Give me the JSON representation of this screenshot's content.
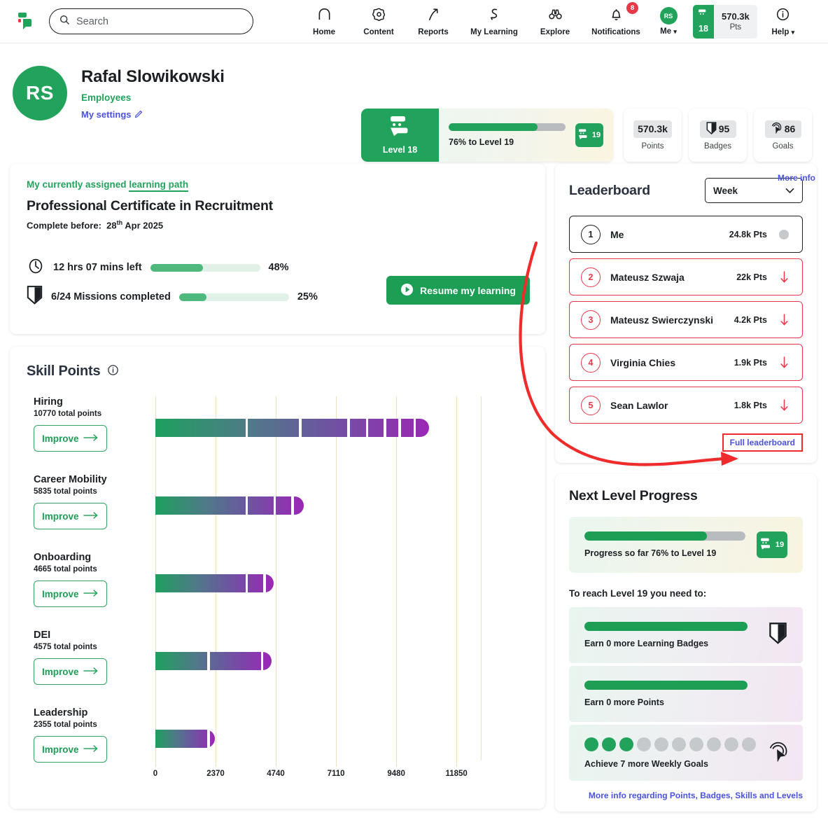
{
  "colors": {
    "brand_green": "#22a35c",
    "link_blue": "#4a52e0",
    "alert_red": "#e8394a",
    "anno_red": "#ef2b2b",
    "gridline": "#f0dfc0",
    "bar_start": "#1ea05e",
    "bar_end": "#9b27b5"
  },
  "topnav": {
    "logo_icon": "speech-bubble-logo-icon",
    "search": {
      "placeholder": "Search",
      "value": "",
      "icon": "search-icon"
    },
    "items": [
      {
        "label": "Home",
        "icon": "home-icon"
      },
      {
        "label": "Content",
        "icon": "gear-flower-icon"
      },
      {
        "label": "Reports",
        "icon": "arrow-trend-up-icon"
      },
      {
        "label": "My Learning",
        "icon": "ribbon-path-icon"
      },
      {
        "label": "Explore",
        "icon": "binoculars-icon"
      },
      {
        "label": "Notifications",
        "icon": "bell-icon",
        "badge": "8"
      }
    ],
    "me": {
      "label": "Me",
      "initials": "RS",
      "chevron": "chevron-down-icon"
    },
    "points_widget": {
      "level": "18",
      "level_icon": "level-badge-icon",
      "value": "570.3k",
      "unit": "Pts"
    },
    "help": {
      "label": "Help",
      "icon": "info-circle-icon",
      "chevron": "chevron-down-icon"
    }
  },
  "profile": {
    "initials": "RS",
    "name": "Rafal Slowikowski",
    "group": "Employees",
    "settings_link": "My settings",
    "settings_icon": "pencil-icon",
    "level_card": {
      "badge_icon": "level-badge-icon",
      "badge_label": "Level 18",
      "progress_pct": 76,
      "progress_text": "76% to Level 19",
      "next_level_chip": "19",
      "chip_icon": "level-badge-icon"
    },
    "stats": [
      {
        "value": "570.3k",
        "caption": "Points",
        "icon": ""
      },
      {
        "value": "95",
        "caption": "Badges",
        "icon": "badge-shield-icon"
      },
      {
        "value": "86",
        "caption": "Goals",
        "icon": "goal-target-icon"
      }
    ],
    "more_info": "More info"
  },
  "learning_path": {
    "eyebrow_prefix": "My currently assigned ",
    "eyebrow_link": "learning path",
    "title": "Professional Certificate in Recruitment",
    "due_label": "Complete before:",
    "due_day": "28",
    "due_suffix": "th",
    "due_rest": " Apr 2025",
    "rows": [
      {
        "icon": "clock-icon",
        "text": "12 hrs 07 mins left",
        "pct": 48,
        "pct_label": "48%"
      },
      {
        "icon": "badge-shield-icon",
        "text": "6/24 Missions completed",
        "pct": 25,
        "pct_label": "25%"
      }
    ],
    "resume_button": {
      "label": "Resume my learning",
      "icon": "play-circle-icon"
    }
  },
  "skill_points": {
    "title": "Skill Points",
    "info_icon": "info-circle-icon",
    "improve_label": "Improve",
    "improve_icon": "arrow-right-icon"
  },
  "chart_data": {
    "type": "bar",
    "title": "Skill Points",
    "orientation": "horizontal",
    "xlabel": "",
    "ylabel": "",
    "xlim": [
      0,
      12810
    ],
    "xticks": [
      0,
      2370,
      4740,
      7110,
      9480,
      11850
    ],
    "xtick_labels": [
      "0",
      "2370",
      "4740",
      "7110",
      "9480",
      "11850"
    ],
    "grid": true,
    "legend": false,
    "categories": [
      "Hiring",
      "Career Mobility",
      "Onboarding",
      "DEI",
      "Leadership"
    ],
    "values": [
      10770,
      5835,
      4665,
      4575,
      2355
    ],
    "value_labels": [
      "10770 total points",
      "5835 total points",
      "4665 total points",
      "4575 total points",
      "2355 total points"
    ],
    "bars": [
      {
        "category": "Hiring",
        "total": 10770,
        "segments": [
          3600,
          2100,
          1900,
          740,
          700,
          580,
          580,
          570
        ]
      },
      {
        "category": "Career Mobility",
        "total": 5835,
        "segments": [
          3600,
          1100,
          700,
          435
        ]
      },
      {
        "category": "Onboarding",
        "total": 4665,
        "segments": [
          3600,
          700,
          365
        ]
      },
      {
        "category": "DEI",
        "total": 4575,
        "segments": [
          2100,
          2100,
          375
        ]
      },
      {
        "category": "Leadership",
        "total": 2355,
        "segments": [
          2100,
          255
        ]
      }
    ]
  },
  "leaderboard": {
    "title": "Leaderboard",
    "period_select": {
      "value": "Week",
      "chevron": "chevron-down-icon"
    },
    "rows": [
      {
        "rank": "1",
        "name": "Me",
        "points": "24.8k Pts",
        "trend": "none",
        "is_me": true
      },
      {
        "rank": "2",
        "name": "Mateusz Szwaja",
        "points": "22k Pts",
        "trend": "down",
        "is_me": false
      },
      {
        "rank": "3",
        "name": "Mateusz Swierczynski",
        "points": "4.2k Pts",
        "trend": "down",
        "is_me": false
      },
      {
        "rank": "4",
        "name": "Virginia Chies",
        "points": "1.9k Pts",
        "trend": "down",
        "is_me": false
      },
      {
        "rank": "5",
        "name": "Sean Lawlor",
        "points": "1.8k Pts",
        "trend": "down",
        "is_me": false
      }
    ],
    "full_link": "Full leaderboard"
  },
  "next_level": {
    "title": "Next Level Progress",
    "hero": {
      "progress_pct": 76,
      "text": "Progress so far 76% to Level 19",
      "chip": "19",
      "chip_icon": "level-badge-icon"
    },
    "need_heading": "To reach Level 19 you need to:",
    "items": [
      {
        "label": "Earn 0 more Learning Badges",
        "kind": "bar",
        "pct": 100,
        "icon": "badge-shield-icon"
      },
      {
        "label": "Earn 0 more Points",
        "kind": "bar",
        "pct": 100,
        "icon": ""
      },
      {
        "label": "Achieve 7 more Weekly Goals",
        "kind": "dots",
        "dots_total": 10,
        "dots_on": 3,
        "icon": "goal-target-icon"
      }
    ],
    "footer_link": "More info regarding Points, Badges, Skills and Levels"
  },
  "annotation": {
    "type": "curved-arrow",
    "color": "#ef2b2b",
    "target": "Full leaderboard",
    "highlight_box": true
  }
}
